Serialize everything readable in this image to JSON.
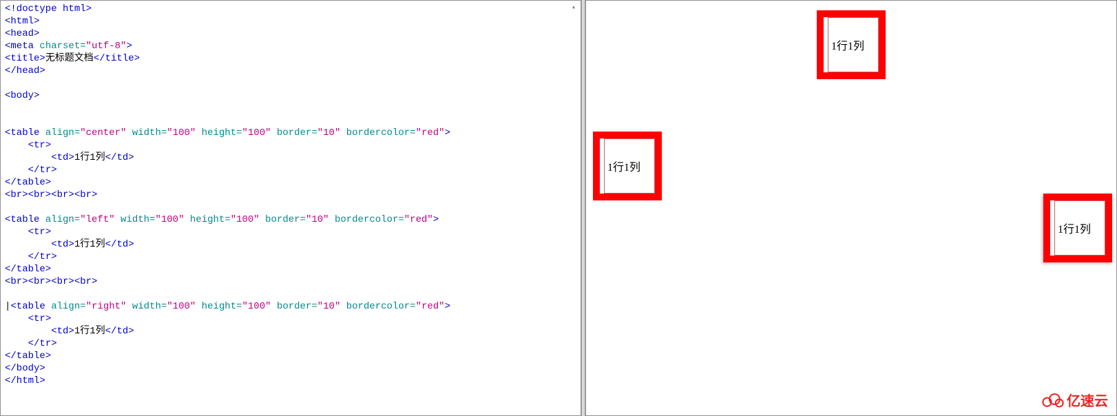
{
  "code": {
    "doctype": "<!doctype html>",
    "html_open": "<html>",
    "head_open": "<head>",
    "meta_tag": "<meta",
    "meta_attr": " charset=",
    "meta_val": "\"utf-8\"",
    "meta_close": ">",
    "title_open": "<title>",
    "title_text": "无标题文档",
    "title_close": "</title>",
    "head_close": "</head>",
    "body_open": "<body>",
    "table_tag": "<table",
    "attr_align": " align=",
    "val_center": "\"center\"",
    "val_left": "\"left\"",
    "val_right": "\"right\"",
    "attr_width": " width=",
    "val_100": "\"100\"",
    "attr_height": " height=",
    "attr_border": " border=",
    "val_10": "\"10\"",
    "attr_bc": " bordercolor=",
    "val_red": "\"red\"",
    "gt": ">",
    "tr_open": "<tr>",
    "td_open": "<td>",
    "cell_text": "1行1列",
    "td_close": "</td>",
    "tr_close": "</tr>",
    "table_close": "</table>",
    "br4": "<br><br><br><br>",
    "body_close": "</body>",
    "html_close": "</html>",
    "cursor": "|"
  },
  "preview": {
    "cell_text": "1行1列"
  },
  "watermark": {
    "text": "亿速云"
  }
}
